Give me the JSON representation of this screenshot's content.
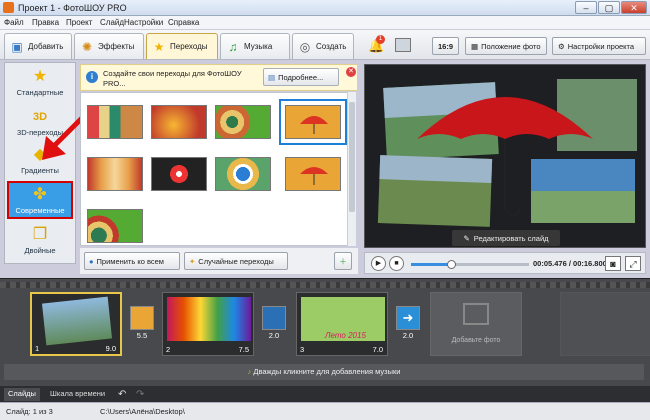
{
  "window": {
    "title": "Проект 1 - ФотоШОУ PRO",
    "min": "–",
    "max": "▢",
    "close": "✕"
  },
  "menu": [
    "Файл",
    "Правка",
    "Проект",
    "Слайд",
    "Настройки",
    "Справка"
  ],
  "tabs": [
    {
      "label": "Добавить",
      "icon": "add-photo-icon"
    },
    {
      "label": "Эффекты",
      "icon": "effects-icon"
    },
    {
      "label": "Переходы",
      "icon": "star-icon"
    },
    {
      "label": "Музыка",
      "icon": "music-icon"
    },
    {
      "label": "Создать",
      "icon": "film-reel-icon"
    }
  ],
  "toolbar": {
    "notif_count": "1",
    "ratio": "16:9",
    "photo_pos": "Положение фото",
    "project_settings": "Настройки проекта"
  },
  "categories": [
    {
      "label": "Стандартные",
      "icon": "star-icon"
    },
    {
      "label": "3D-переходы",
      "icon": "3d-icon"
    },
    {
      "label": "Градиенты",
      "icon": "gradient-icon"
    },
    {
      "label": "Современные",
      "icon": "puzzle-icon"
    },
    {
      "label": "Двойные",
      "icon": "double-icon"
    }
  ],
  "tip": {
    "text": "Создайте свои переходы для ФотоШОУ PRO...",
    "more": "Подробнее..."
  },
  "grid_actions": {
    "apply_all": "Применить ко всем",
    "random": "Случайные переходы"
  },
  "preview": {
    "edit_slide": "Редактировать слайд"
  },
  "player": {
    "time": "00:05.476 / 00:16.800"
  },
  "slides": [
    {
      "num": "1",
      "dur": "9.0"
    },
    {
      "num": "2",
      "dur": "7.5"
    },
    {
      "num": "3",
      "dur": "7.0"
    }
  ],
  "transitions": [
    "5.5",
    "2.0",
    "2.0"
  ],
  "slide_caption": "Лето 2015",
  "add_photo": "Добавьте фото",
  "music_hint": "Дважды кликните для добавления музыки",
  "bottom_tabs": [
    "Слайды",
    "Шкала времени"
  ],
  "status": {
    "slide": "Слайд: 1 из 3",
    "path": "C:\\Users\\Алёна\\Desktop\\"
  },
  "colors": {
    "accent": "#3a9ee6",
    "highlight": "#d40000"
  }
}
